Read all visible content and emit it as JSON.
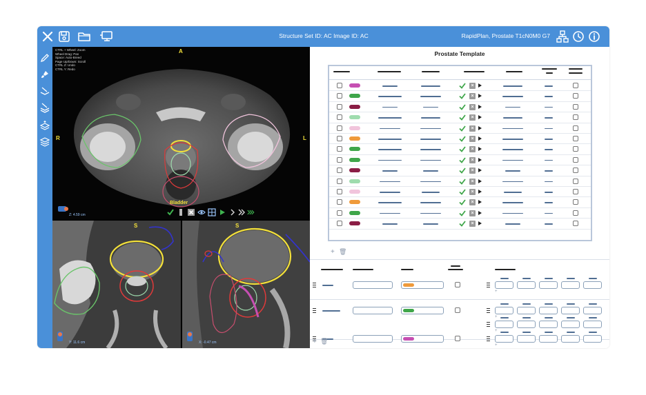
{
  "topbar": {
    "title": "Structure Set ID: AC Image ID: AC",
    "plan": "RapidPlan, Prostate T1cN0M0 G7",
    "icons": [
      "close-icon",
      "save-icon",
      "folder-icon",
      "monitor-icon",
      "network-icon",
      "clock-icon",
      "info-icon"
    ]
  },
  "sidebar": {
    "icons": [
      "pencil-icon",
      "brush-icon",
      "layer-icon",
      "layers-icon",
      "layers-add-icon",
      "layers-stack-icon"
    ]
  },
  "viewer": {
    "main": {
      "top_label": "A",
      "left_label": "R",
      "right_label": "L",
      "overlay_lines": [
        "CTRL + Wheel: Zoom",
        "Wheel Drag: Pan",
        "Space: Auto-Breed",
        "Page Up/Down: Scroll",
        "CTRL Z: Undo",
        "CTRL Y: Redo"
      ],
      "zoom": "Z: 4.59 cm",
      "structure_label": "Bladder"
    },
    "coronal": {
      "top_label": "S",
      "zoom": "Y: 11.6 cm"
    },
    "sagittal": {
      "top_label": "S",
      "zoom": "X: -0.47 cm"
    }
  },
  "panel": {
    "title": "Prostate Template",
    "rows": [
      {
        "color": "#c64fb2"
      },
      {
        "color": "#3fa64a"
      },
      {
        "color": "#8a1d45"
      },
      {
        "color": "#9fdcae"
      },
      {
        "color": "#f1c4dc"
      },
      {
        "color": "#ef9a3b"
      },
      {
        "color": "#3fa64a"
      },
      {
        "color": "#3fa64a"
      },
      {
        "color": "#8a1d45"
      },
      {
        "color": "#9fdcae"
      },
      {
        "color": "#f1c4dc"
      },
      {
        "color": "#ef9a3b"
      },
      {
        "color": "#3fa64a"
      },
      {
        "color": "#8a1d45"
      }
    ],
    "bottom_rows": [
      {
        "color": "#ef9a3b"
      },
      {
        "color": "#3fa64a"
      },
      {
        "color": "#c64fb2"
      }
    ],
    "add_symbol": "+",
    "delete_symbol": "🗑"
  }
}
